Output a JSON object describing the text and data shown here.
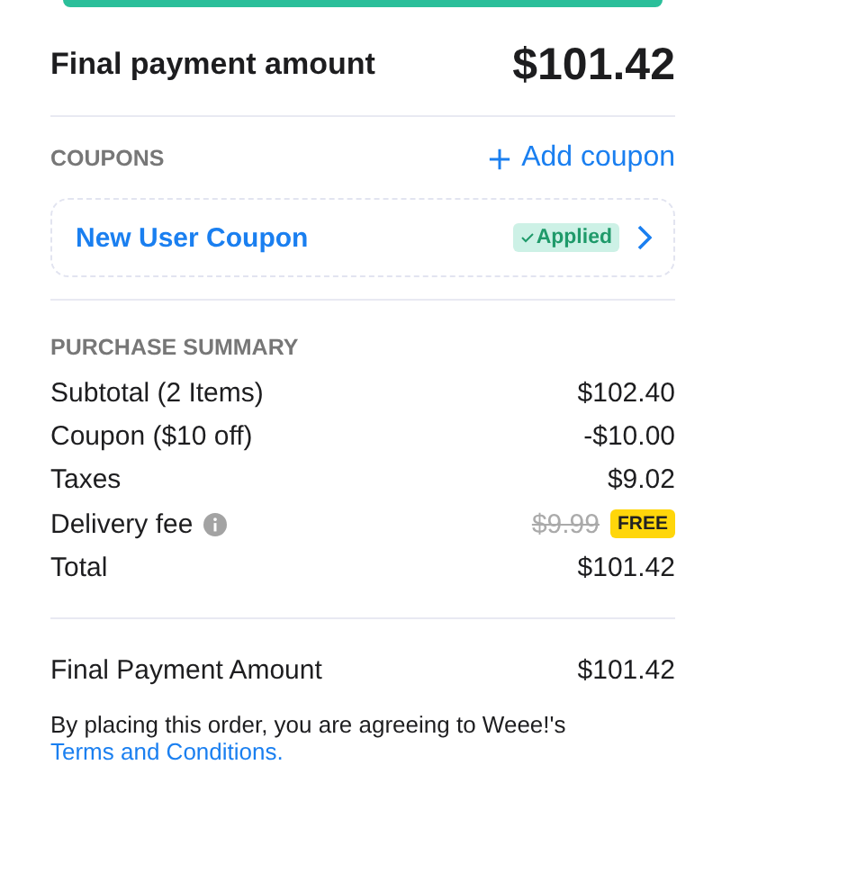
{
  "header": {
    "label": "Final payment amount",
    "amount": "$101.42"
  },
  "coupons": {
    "heading": "COUPONS",
    "add_label": "Add coupon",
    "items": [
      {
        "name": "New User Coupon",
        "status": "Applied",
        "applied": true
      }
    ]
  },
  "summary": {
    "heading": "PURCHASE SUMMARY",
    "rows": [
      {
        "label": "Subtotal (2 Items)",
        "value": "$102.40"
      },
      {
        "label": "Coupon ($10 off)",
        "value": "-$10.00"
      },
      {
        "label": "Taxes",
        "value": "$9.02"
      },
      {
        "label": "Delivery fee",
        "value": "$9.99",
        "info": true,
        "struck": true,
        "badge": "FREE"
      },
      {
        "label": "Total",
        "value": "$101.42"
      }
    ]
  },
  "final": {
    "label": "Final Payment Amount",
    "amount": "$101.42"
  },
  "agreement": {
    "text": "By placing this order, you are agreeing to Weee!'s",
    "link": "Terms and Conditions."
  }
}
